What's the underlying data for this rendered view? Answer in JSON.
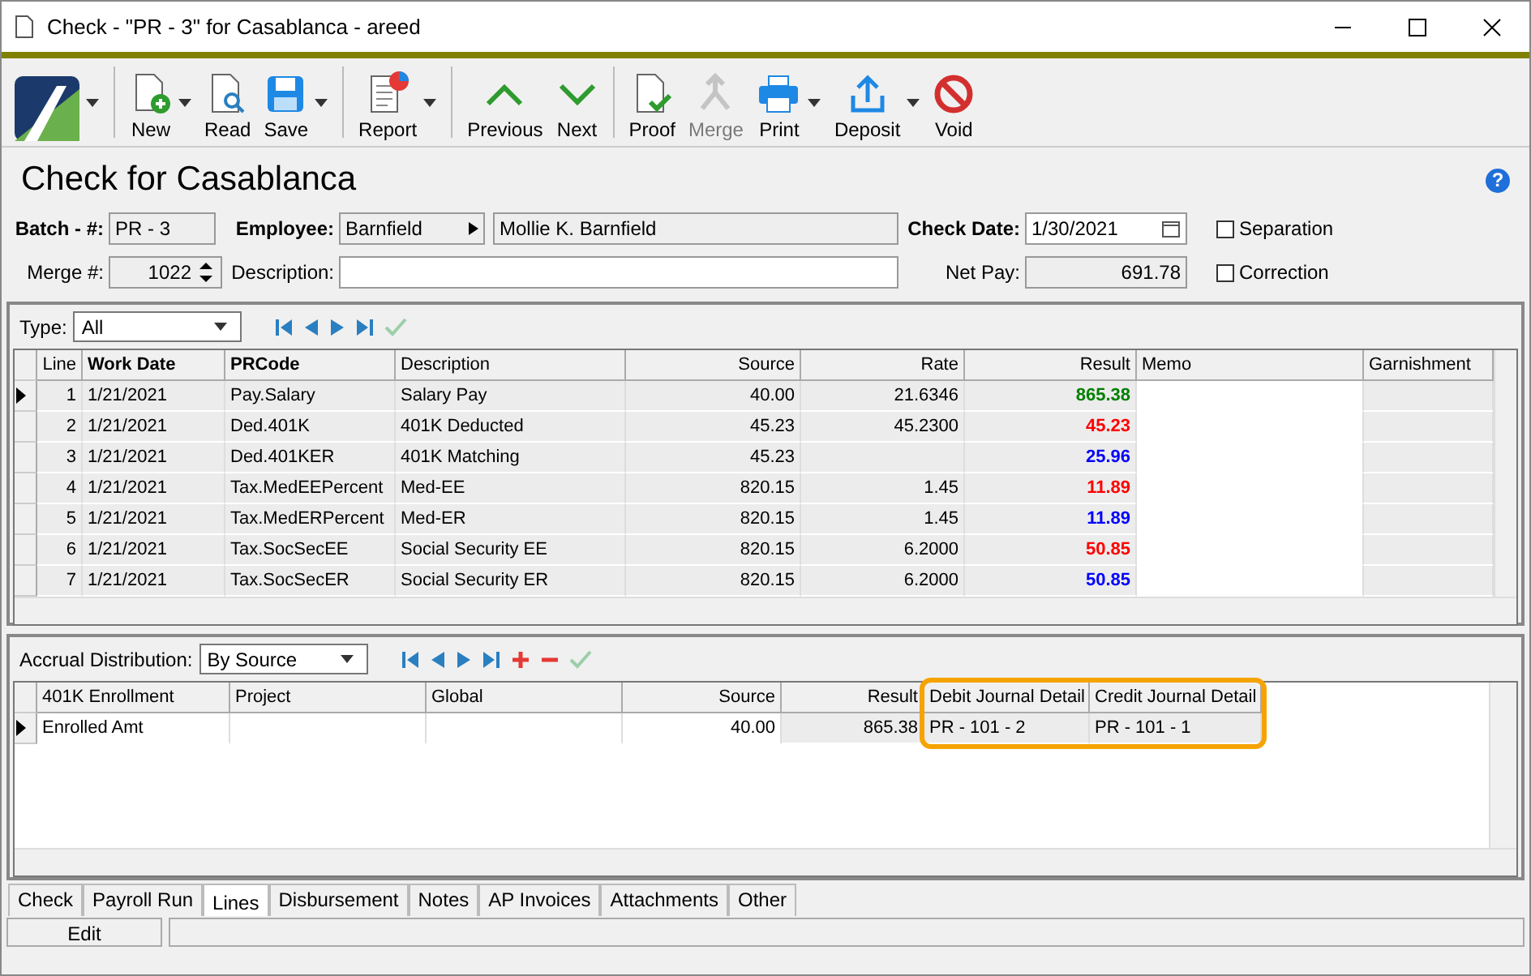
{
  "window": {
    "title": "Check - \"PR - 3\" for Casablanca - areed"
  },
  "toolbar": [
    {
      "kind": "logo",
      "dropdown": true,
      "disabled": false
    },
    {
      "kind": "new",
      "label": "New",
      "dropdown": true,
      "disabled": false
    },
    {
      "kind": "read",
      "label": "Read",
      "dropdown": false,
      "disabled": false
    },
    {
      "kind": "save",
      "label": "Save",
      "dropdown": true,
      "disabled": false
    },
    {
      "kind": "report",
      "label": "Report",
      "dropdown": true,
      "disabled": false
    },
    {
      "kind": "previous",
      "label": "Previous",
      "dropdown": false,
      "disabled": false
    },
    {
      "kind": "next",
      "label": "Next",
      "dropdown": false,
      "disabled": false
    },
    {
      "kind": "proof",
      "label": "Proof",
      "dropdown": false,
      "disabled": false
    },
    {
      "kind": "merge",
      "label": "Merge",
      "dropdown": false,
      "disabled": true
    },
    {
      "kind": "print",
      "label": "Print",
      "dropdown": true,
      "disabled": false
    },
    {
      "kind": "deposit",
      "label": "Deposit",
      "dropdown": true,
      "disabled": false
    },
    {
      "kind": "void",
      "label": "Void",
      "dropdown": false,
      "disabled": false
    }
  ],
  "heading": "Check for Casablanca",
  "help": "?",
  "form": {
    "batch_label": "Batch - #:",
    "batch": "PR - 3",
    "employee_label": "Employee:",
    "employee_code": "Barnfield",
    "employee_name": "Mollie K. Barnfield",
    "check_date_label": "Check Date:",
    "check_date": "1/30/2021",
    "merge_label": "Merge #:",
    "merge": "1022",
    "description_label": "Description:",
    "net_pay_label": "Net Pay:",
    "net_pay": "691.78",
    "checkboxes": [
      {
        "label": "Separation",
        "checked": false
      },
      {
        "label": "Correction",
        "checked": false
      }
    ]
  },
  "lines": {
    "type_label": "Type:",
    "type": "All",
    "columns": [
      {
        "label": "Line",
        "bold": false
      },
      {
        "label": "Work Date",
        "bold": true
      },
      {
        "label": "PRCode",
        "bold": true
      },
      {
        "label": "Description",
        "bold": false
      },
      {
        "label": "Source",
        "bold": false
      },
      {
        "label": "Rate",
        "bold": false
      },
      {
        "label": "Result",
        "bold": false
      },
      {
        "label": "Memo",
        "bold": false
      },
      {
        "label": "Garnishment",
        "bold": false
      }
    ],
    "rows": [
      {
        "selected": true,
        "color": "#008000",
        "cells": [
          "1",
          "1/21/2021",
          "Pay.Salary",
          "Salary Pay",
          "40.00",
          "21.6346",
          "865.38",
          "",
          ""
        ]
      },
      {
        "selected": false,
        "color": "#ff0000",
        "cells": [
          "2",
          "1/21/2021",
          "Ded.401K",
          "401K Deducted",
          "45.23",
          "45.2300",
          "45.23",
          "",
          ""
        ]
      },
      {
        "selected": false,
        "color": "#0000ff",
        "cells": [
          "3",
          "1/21/2021",
          "Ded.401KER",
          "401K Matching",
          "45.23",
          "",
          "25.96",
          "",
          ""
        ]
      },
      {
        "selected": false,
        "color": "#ff0000",
        "cells": [
          "4",
          "1/21/2021",
          "Tax.MedEEPercent",
          "Med-EE",
          "820.15",
          "1.45",
          "11.89",
          "",
          ""
        ]
      },
      {
        "selected": false,
        "color": "#0000ff",
        "cells": [
          "5",
          "1/21/2021",
          "Tax.MedERPercent",
          "Med-ER",
          "820.15",
          "1.45",
          "11.89",
          "",
          ""
        ]
      },
      {
        "selected": false,
        "color": "#ff0000",
        "cells": [
          "6",
          "1/21/2021",
          "Tax.SocSecEE",
          "Social Security EE",
          "820.15",
          "6.2000",
          "50.85",
          "",
          ""
        ]
      },
      {
        "selected": false,
        "color": "#0000ff",
        "cells": [
          "7",
          "1/21/2021",
          "Tax.SocSecER",
          "Social Security ER",
          "820.15",
          "6.2000",
          "50.85",
          "",
          ""
        ]
      }
    ]
  },
  "accrual": {
    "label": "Accrual Distribution:",
    "value": "By Source",
    "columns": [
      {
        "label": "401K Enrollment",
        "highlighted": false
      },
      {
        "label": "Project",
        "highlighted": false
      },
      {
        "label": "Global",
        "highlighted": false
      },
      {
        "label": "Source",
        "highlighted": false
      },
      {
        "label": "Result",
        "highlighted": false
      },
      {
        "label": "Debit Journal Detail",
        "highlighted": true
      },
      {
        "label": "Credit Journal Detail",
        "highlighted": true
      }
    ],
    "rows": [
      {
        "selected": true,
        "cells": [
          "Enrolled Amt",
          "",
          "",
          "40.00",
          "865.38",
          "PR - 101 - 2",
          "PR - 101 - 1"
        ]
      }
    ]
  },
  "tabs": [
    {
      "label": "Check",
      "selected": false
    },
    {
      "label": "Payroll Run",
      "selected": false
    },
    {
      "label": "Lines",
      "selected": true
    },
    {
      "label": "Disbursement",
      "selected": false
    },
    {
      "label": "Notes",
      "selected": false
    },
    {
      "label": "AP Invoices",
      "selected": false
    },
    {
      "label": "Attachments",
      "selected": false
    },
    {
      "label": "Other",
      "selected": false
    }
  ],
  "status_bar": {
    "mode": "Edit"
  }
}
